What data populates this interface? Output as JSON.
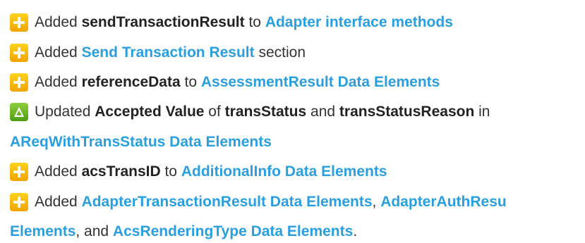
{
  "colors": {
    "link": "#2a9fe0",
    "text": "#333333",
    "add_icon": "#f7b500",
    "update_icon": "#6cb52a"
  },
  "entries": [
    {
      "icon": "plus-icon",
      "line1": {
        "t1": "Added ",
        "b1": "sendTransactionResult",
        "t2": " to ",
        "l1": "Adapter interface methods"
      }
    },
    {
      "icon": "plus-icon",
      "line1": {
        "t1": "Added ",
        "l1": "Send Transaction Result",
        "t2": " section"
      }
    },
    {
      "icon": "plus-icon",
      "line1": {
        "t1": "Added ",
        "b1": "referenceData",
        "t2": " to ",
        "l1": "AssessmentResult Data Elements"
      }
    },
    {
      "icon": "delta-icon",
      "line1": {
        "t1": "Updated ",
        "b1": "Accepted Value",
        "t2": " of ",
        "b2": "transStatus",
        "t3": " and ",
        "b3": "transStatusReason",
        "t4": " in"
      },
      "line2": {
        "l1": "AReqWithTransStatus Data Elements"
      }
    },
    {
      "icon": "plus-icon",
      "line1": {
        "t1": "Added ",
        "b1": "acsTransID",
        "t2": " to ",
        "l1": "AdditionalInfo Data Elements"
      }
    },
    {
      "icon": "plus-icon",
      "line1": {
        "t1": "Added ",
        "l1": "AdapterTransactionResult Data Elements",
        "t2": ", ",
        "l2": "AdapterAuthResu"
      },
      "line2": {
        "l1": "Elements",
        "t1": ", and ",
        "l2": "AcsRenderingType Data Elements",
        "t2": "."
      }
    }
  ]
}
